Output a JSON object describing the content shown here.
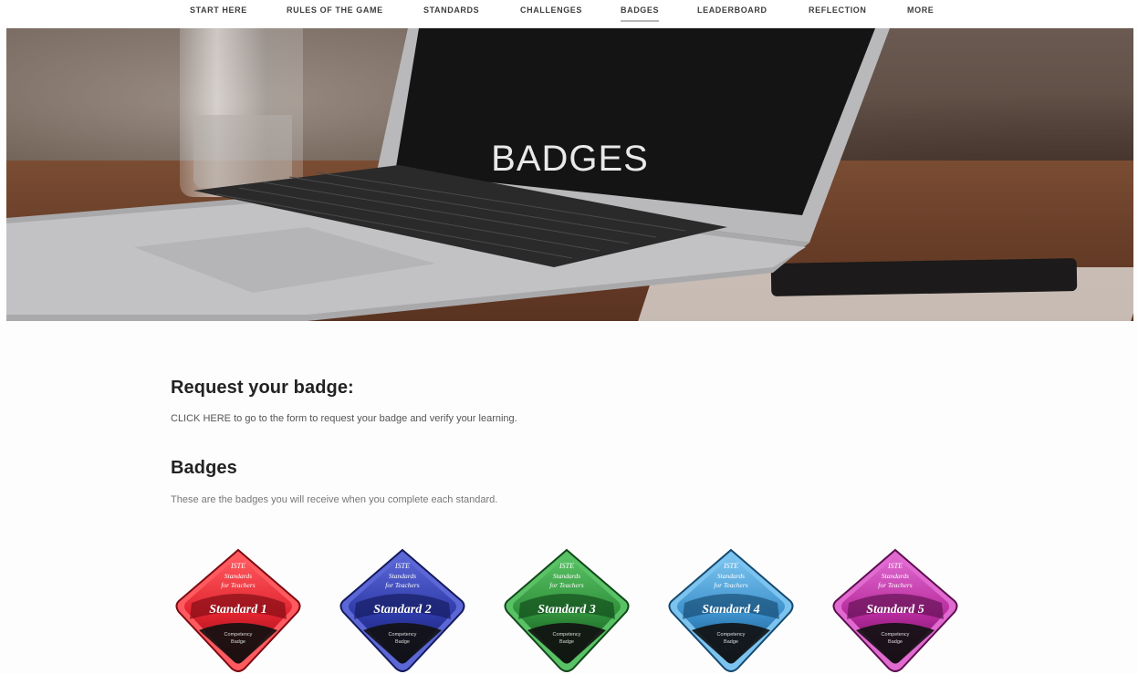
{
  "nav": {
    "items": [
      {
        "label": "START HERE"
      },
      {
        "label": "RULES OF THE GAME"
      },
      {
        "label": "STANDARDS"
      },
      {
        "label": "CHALLENGES"
      },
      {
        "label": "BADGES",
        "active": true
      },
      {
        "label": "LEADERBOARD"
      },
      {
        "label": "REFLECTION"
      },
      {
        "label": "MORE"
      }
    ]
  },
  "hero": {
    "title": "BADGES"
  },
  "request": {
    "heading": "Request your badge:",
    "link_text": "CLICK HERE",
    "text": " to go to the form to request your badge and verify your learning."
  },
  "badges_section": {
    "heading": "Badges",
    "text": "These are the badges you will receive when you complete each standard."
  },
  "badges": [
    {
      "org": "ISTE",
      "line1": "Standards",
      "line2": "for Teachers",
      "title": "Standard 1",
      "footer1": "Competency",
      "footer2": "Badge",
      "color": "#e0232f",
      "light": "#ff5a5f",
      "dark": "#7d0b12"
    },
    {
      "org": "ISTE",
      "line1": "Standards",
      "line2": "for Teachers",
      "title": "Standard 2",
      "footer1": "Competency",
      "footer2": "Badge",
      "color": "#2e3aa8",
      "light": "#5b67d6",
      "dark": "#141a5c"
    },
    {
      "org": "ISTE",
      "line1": "Standards",
      "line2": "for Teachers",
      "title": "Standard 3",
      "footer1": "Competency",
      "footer2": "Badge",
      "color": "#2f8f3a",
      "light": "#59c265",
      "dark": "#11481a"
    },
    {
      "org": "ISTE",
      "line1": "Standards",
      "line2": "for Teachers",
      "title": "Standard 4",
      "footer1": "Competency",
      "footer2": "Badge",
      "color": "#3b8fcb",
      "light": "#7cc4ef",
      "dark": "#164a70"
    },
    {
      "org": "ISTE",
      "line1": "Standards",
      "line2": "for Teachers",
      "title": "Standard 5",
      "footer1": "Competency",
      "footer2": "Badge",
      "color": "#b62a9c",
      "light": "#e06ad0",
      "dark": "#5d0f4f"
    }
  ]
}
